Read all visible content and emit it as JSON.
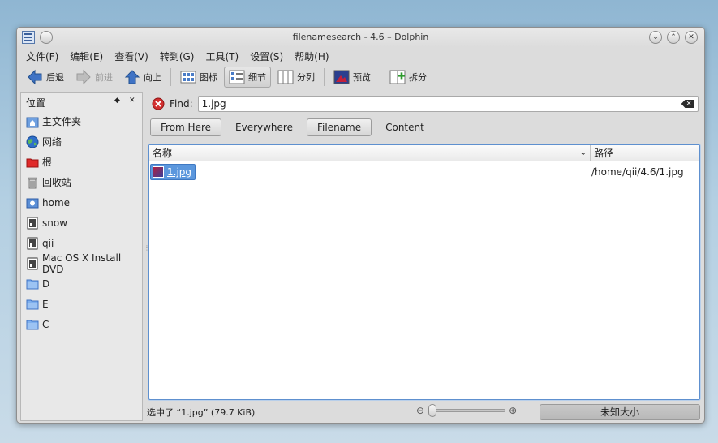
{
  "window": {
    "title": "filenamesearch - 4.6 – Dolphin"
  },
  "menu": [
    "文件(F)",
    "编辑(E)",
    "查看(V)",
    "转到(G)",
    "工具(T)",
    "设置(S)",
    "帮助(H)"
  ],
  "toolbar": {
    "back": "后退",
    "forward": "前进",
    "up": "向上",
    "icons": "图标",
    "details": "细节",
    "columns": "分列",
    "preview": "预览",
    "split": "拆分"
  },
  "sidebar": {
    "title": "位置",
    "items": [
      {
        "label": "主文件夹",
        "icon": "home-folder-icon"
      },
      {
        "label": "网络",
        "icon": "network-globe-icon"
      },
      {
        "label": "根",
        "icon": "root-folder-icon"
      },
      {
        "label": "回收站",
        "icon": "trash-icon"
      },
      {
        "label": "home",
        "icon": "drive-icon"
      },
      {
        "label": "snow",
        "icon": "drive-icon"
      },
      {
        "label": "qii",
        "icon": "drive-icon"
      },
      {
        "label": "Mac OS X Install DVD",
        "icon": "drive-icon"
      },
      {
        "label": "D",
        "icon": "folder-icon"
      },
      {
        "label": "E",
        "icon": "folder-icon"
      },
      {
        "label": "C",
        "icon": "folder-icon"
      }
    ]
  },
  "find": {
    "label": "Find:",
    "value": "1.jpg"
  },
  "filters": {
    "from_here": "From Here",
    "everywhere": "Everywhere",
    "filename": "Filename",
    "content": "Content"
  },
  "list": {
    "columns": {
      "name": "名称",
      "path": "路径"
    },
    "rows": [
      {
        "name": "1.jpg",
        "path": "/home/qii/4.6/1.jpg"
      }
    ]
  },
  "status": {
    "text": "选中了 “1.jpg” (79.7 KiB)",
    "free_space": "未知大小",
    "zoom_level": 0.0
  },
  "colors": {
    "selection": "#5b97dd",
    "accent_border": "#5e90cf"
  }
}
